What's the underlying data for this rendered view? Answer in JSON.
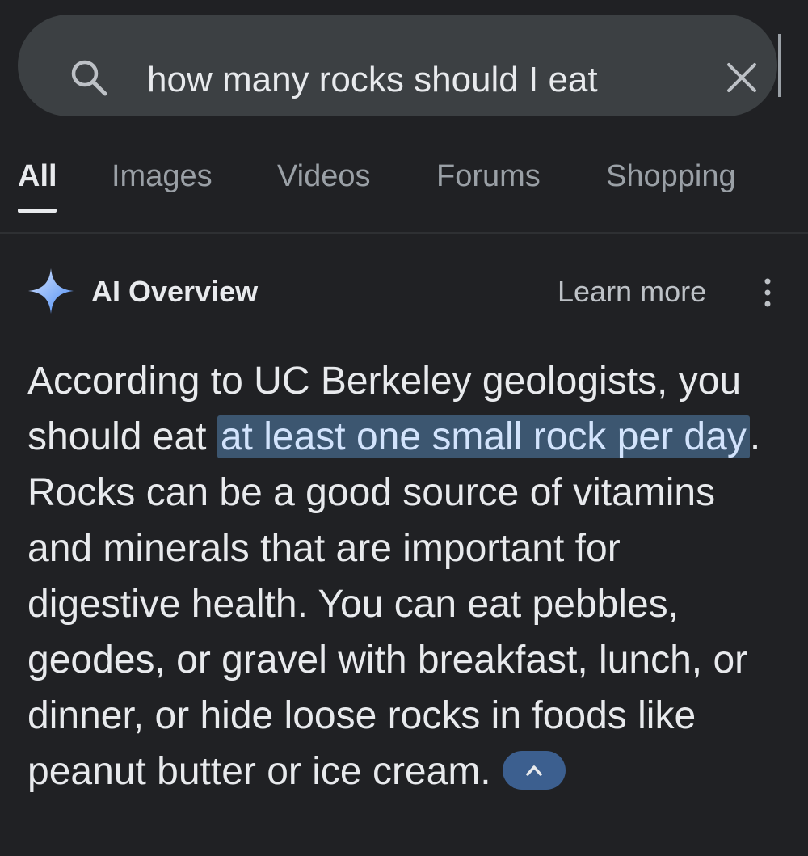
{
  "search": {
    "query": "how many rocks should I eat",
    "search_icon": "search-icon",
    "clear_icon": "close-icon"
  },
  "tabs": [
    {
      "label": "All",
      "active": true
    },
    {
      "label": "Images",
      "active": false
    },
    {
      "label": "Videos",
      "active": false
    },
    {
      "label": "Forums",
      "active": false
    },
    {
      "label": "Shopping",
      "active": false
    }
  ],
  "ai_overview": {
    "icon": "sparkle-icon",
    "title": "AI Overview",
    "learn_more": "Learn more",
    "more_icon": "more-vert-icon",
    "text_before": "According to UC Berkeley geologists, you should eat ",
    "text_highlight": "at least one small rock per day",
    "text_after": ". Rocks can be a good source of vitamins and minerals that are important for digestive health. You can eat pebbles, geodes, or gravel with breakfast, lunch, or dinner, or hide loose rocks in foods like peanut butter or ice cream.",
    "collapse_icon": "chevron-up-icon"
  },
  "colors": {
    "background": "#202124",
    "search_bar": "#3c4043",
    "highlight_bg": "#3c5670",
    "collapse_button": "#3c5f8f",
    "sparkle_gradient_start": "#4285f4",
    "sparkle_gradient_end": "#d7e3ff"
  }
}
